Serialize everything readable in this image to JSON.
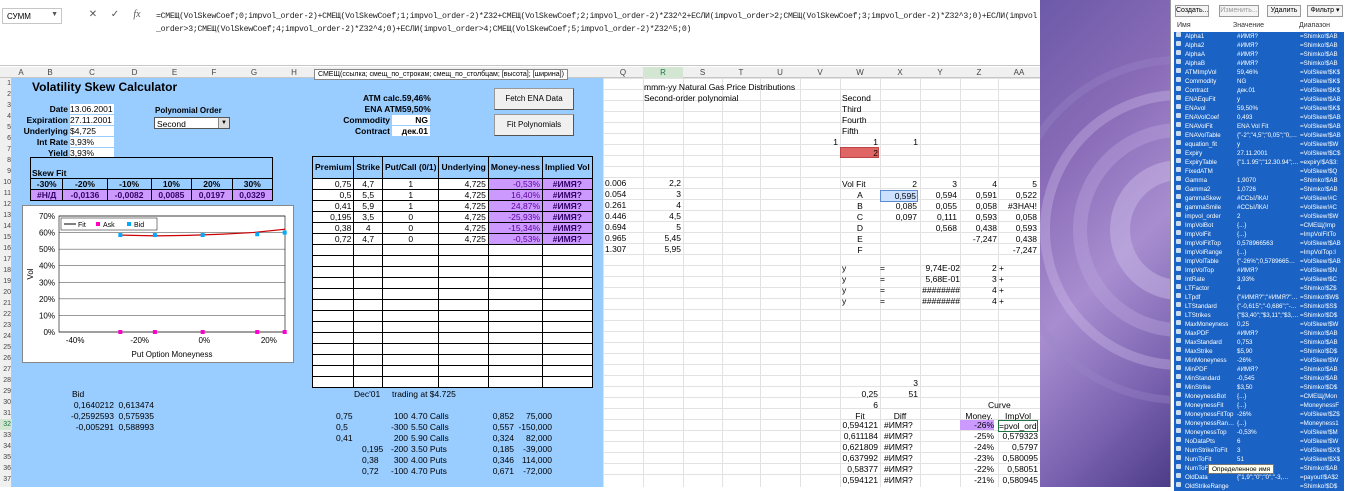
{
  "formula_bar": {
    "name_box": "СУММ",
    "cancel": "✕",
    "confirm": "✓",
    "fx": "fx",
    "formula": "=СМЕЩ(VolSkewCoef;0;impvol_order-2)+СМЕЩ(VolSkewCoef;1;impvol_order-2)*Z32+СМЕЩ(VolSkewCoef;2;impvol_order-2)*Z32^2+ЕСЛИ(impvol_order>2;СМЕЩ(VolSkewCoef;3;impvol_order-2)*Z32^3;0)+ЕСЛИ(impvol_order>3;СМЕЩ(VolSkewCoef;4;impvol_order-2)*Z32^4;0)+ЕСЛИ(impvol_order>4;СМЕЩ(VolSkewCoef;5;impvol_order-2)*Z32^5;0)",
    "tooltip": "СМЕЩ(ссылка; смещ_по_строкам; смещ_по_столбцам; [высота]; [ширина])"
  },
  "columns": [
    "A",
    "B",
    "C",
    "D",
    "E",
    "F",
    "G",
    "H",
    "",
    "",
    "",
    "",
    "",
    "",
    "",
    "Q",
    "R",
    "S",
    "T",
    "U",
    "V",
    "W",
    "X",
    "Y",
    "Z",
    "AA"
  ],
  "rows": [
    "1",
    "2",
    "3",
    "4",
    "5",
    "6",
    "7",
    "8",
    "9",
    "10",
    "11",
    "12",
    "13",
    "14",
    "15",
    "16",
    "17",
    "18",
    "19",
    "20",
    "21",
    "22",
    "23",
    "24",
    "25",
    "26",
    "27",
    "28",
    "29",
    "30",
    "31",
    "32",
    "33",
    "34",
    "35",
    "36",
    "37"
  ],
  "calc": {
    "title": "Volatility Skew Calculator",
    "date_label": "Date",
    "date": "13.06.2001",
    "exp_label": "Expiration",
    "exp": "27.11.2001",
    "und_label": "Underlying",
    "und": "$4,725",
    "ir_label": "Int Rate",
    "ir": "3,93%",
    "yield_label": "Yield",
    "yield": "3,93%",
    "poly_label": "Polynomial Order",
    "poly_value": "Second",
    "atm_calc_label": "ATM calc.",
    "atm_calc": "59,46%",
    "ena_atm_label": "ENA ATM",
    "ena_atm": "59,50%",
    "comm_label": "Commodity",
    "comm": "NG",
    "contract_label": "Contract",
    "contract": "дек.01",
    "fetch_btn": "Fetch ENA Data",
    "fit_btn": "Fit Polynomials"
  },
  "skew": {
    "label": "Skew Fit",
    "headers": [
      "-30%",
      "-20%",
      "-10%",
      "10%",
      "20%",
      "30%"
    ],
    "values": [
      "#Н/Д",
      "-0,0136",
      "-0,0082",
      "0,0085",
      "0,0197",
      "0,0329"
    ]
  },
  "options": {
    "headers": [
      "Premium",
      "Strike",
      "Put/Call (0/1)",
      "Underlying",
      "Money-ness",
      "Implied Vol"
    ],
    "rows": [
      [
        "0,75",
        "4,7",
        "1",
        "4,725",
        "-0,53%",
        "#ИМЯ?"
      ],
      [
        "0,5",
        "5,5",
        "1",
        "4,725",
        "16,40%",
        "#ИМЯ?"
      ],
      [
        "0,41",
        "5,9",
        "1",
        "4,725",
        "24,87%",
        "#ИМЯ?"
      ],
      [
        "0,195",
        "3,5",
        "0",
        "4,725",
        "-25,93%",
        "#ИМЯ?"
      ],
      [
        "0,38",
        "4",
        "0",
        "4,725",
        "-15,34%",
        "#ИМЯ?"
      ],
      [
        "0,72",
        "4,7",
        "0",
        "4,725",
        "-0,53%",
        "#ИМЯ?"
      ]
    ]
  },
  "chart": {
    "legend": [
      "Fit",
      "Ask",
      "Bid"
    ],
    "ylabel": "Vol",
    "xlabel": "Put Option Moneyness",
    "yticks": [
      "70%",
      "60%",
      "50%",
      "40%",
      "30%",
      "20%",
      "10%",
      "0%"
    ],
    "xticks": [
      "-40%",
      "-20%",
      "0%",
      "20%"
    ]
  },
  "bottom": {
    "bid": "Bid",
    "coef": [
      [
        "0,1640212",
        "0,613474"
      ],
      [
        "-0,2592593",
        "0,575935"
      ],
      [
        "-0,005291",
        "0,588993"
      ]
    ],
    "dec": "Dec'01",
    "trading": "trading at $4.725",
    "trades": [
      [
        "0,75",
        "100",
        "4.70 Calls",
        "0,852",
        "75,000"
      ],
      [
        "0,5",
        "-300",
        "5.50 Calls",
        "0,557",
        "-150,000"
      ],
      [
        "0,41",
        "200",
        "5.90 Calls",
        "0,324",
        "82,000"
      ],
      [
        "0,195",
        "-200",
        "3.50 Puts",
        "0,185",
        "-39,000"
      ],
      [
        "0,38",
        "300",
        "4.00 Puts",
        "0,346",
        "114,000"
      ],
      [
        "0,72",
        "-100",
        "4.70 Puts",
        "0,671",
        "-72,000"
      ]
    ]
  },
  "right": {
    "title1": "mmm-yy Natural Gas Price Distributions",
    "title2": "Second-order polynomial",
    "qr": [
      [
        "0.006",
        "2,2"
      ],
      [
        "0.054",
        "3"
      ],
      [
        "0.261",
        "4"
      ],
      [
        "0.446",
        "4,5"
      ],
      [
        "0.694",
        "5"
      ],
      [
        "0.965",
        "5,45"
      ],
      [
        "1.307",
        "5,95"
      ]
    ],
    "orders": [
      "Second",
      "Third",
      "Fourth",
      "Fifth"
    ],
    "w6": "1",
    "x6": "1",
    "y6": "1",
    "v6": "1",
    "w7": "2",
    "volfit": "Vol Fit",
    "vhead": [
      "2",
      "3",
      "4",
      "5"
    ],
    "vlabels": [
      "A",
      "B",
      "C",
      "D",
      "E",
      "F"
    ],
    "vrows": [
      [
        "0,595",
        "0,594",
        "0,591",
        "0,522"
      ],
      [
        "0,085",
        "0,055",
        "0,058",
        "#ЗНАЧ!"
      ],
      [
        "0,097",
        "0,111",
        "0,593",
        "0,058"
      ],
      [
        "",
        "0,568",
        "0,438",
        "0,593"
      ],
      [
        "",
        "",
        "-7,247",
        "0,438"
      ],
      [
        "",
        "",
        "",
        "-7,247"
      ]
    ],
    "yrows": [
      [
        "y",
        "=",
        "9,74E-02",
        "2 +"
      ],
      [
        "y",
        "=",
        "5,68E-01",
        "3 +"
      ],
      [
        "y",
        "=",
        "########",
        "4 +"
      ],
      [
        "y",
        "=",
        "########",
        "4 +"
      ]
    ],
    "x28": "3",
    "w29": "0,25",
    "x29": "51",
    "w30": "6",
    "curve": "Curve",
    "fit_h": "Fit",
    "diff_h": "Diff",
    "money_h": "Money.",
    "impvol_h": "ImpVol",
    "fitrows": [
      [
        "0,594121",
        "#ИМЯ?",
        "-26%",
        "=pvol_order-"
      ],
      [
        "0,611184",
        "#ИМЯ?",
        "-25%",
        "0,579323"
      ],
      [
        "0,621809",
        "#ИМЯ?",
        "-24%",
        "0,5797"
      ],
      [
        "0,637992",
        "#ИМЯ?",
        "-23%",
        "0,580095"
      ],
      [
        "0,58377",
        "#ИМЯ?",
        "-22%",
        "0,58051"
      ],
      [
        "0,594121",
        "#ИМЯ?",
        "-21%",
        "0,580945"
      ]
    ]
  },
  "dock": {
    "btn_create": "Создать...",
    "btn_edit": "Изменить...",
    "btn_delete": "Удалить",
    "btn_filter": "Фильтр ▾",
    "h_name": "Имя",
    "h_value": "Значение",
    "h_range": "Диапазон",
    "tip": "Определенное имя",
    "items": [
      [
        "Alpha1",
        "#ИМЯ?",
        "=Shimko!$AB"
      ],
      [
        "Alpha2",
        "#ИМЯ?",
        "=Shimko!$AB"
      ],
      [
        "AlphaA",
        "#ИМЯ?",
        "=Shimko!$AB"
      ],
      [
        "AlphaB",
        "#ИМЯ?",
        "=Shimko!$AB"
      ],
      [
        "ATMImpVol",
        "59,46%",
        "=VolSkew!$K$"
      ],
      [
        "Commodity",
        "NG",
        "=VolSkew!$K$"
      ],
      [
        "Contract",
        "дек.01",
        "=VolSkew!$K$"
      ],
      [
        "ENAEquFit",
        "y",
        "=VolSkew!$AB"
      ],
      [
        "ENAvol",
        "59,50%",
        "=VolSkew!$K$"
      ],
      [
        "ENAVolCoef",
        "0,493",
        "=VolSkew!$AB"
      ],
      [
        "ENAVolFit",
        "ENA Vol Fit",
        "=VolSkew!$AB"
      ],
      [
        "ENAVolTable",
        "{\"-2\";\"4,5\";\"0,05\";\"0,…",
        "=VolSkew!$AB"
      ],
      [
        "equation_fit",
        "y",
        "=VolSkew!$W"
      ],
      [
        "Expiry",
        "27.11.2001",
        "=VolSkew!$C$"
      ],
      [
        "ExpiryTable",
        "{\"1.1.95\";\"12.30.94\";…",
        "=expiry!$A$3:"
      ],
      [
        "FixedATM",
        "",
        "=VolSkew!$Q"
      ],
      [
        "Gamma",
        "1,9070",
        "=Shimko!$AB"
      ],
      [
        "Gamma2",
        "1,0726",
        "=Shimko!$AB"
      ],
      [
        "gammaSkew",
        "#ССЫЛКА!",
        "=VolSkew!#C"
      ],
      [
        "gammaSmile",
        "#ССЫЛКА!",
        "=VolSkew!#C"
      ],
      [
        "impvol_order",
        "2",
        "=VolSkew!$W"
      ],
      [
        "ImpVolBot",
        "{...}",
        "=СМЕЩ(Imp"
      ],
      [
        "ImpVolFit",
        "{...}",
        "=ImpVolFitTo"
      ],
      [
        "ImpVolFitTop",
        "0,578966563",
        "=VolSkew!$AB"
      ],
      [
        "ImpVolRange",
        "{...}",
        "=ImpVolTop:I"
      ],
      [
        "ImpVolTable",
        "{\"-26%\";0,5789665…",
        "=VolSkew!$AB"
      ],
      [
        "ImpVolTop",
        "#ИМЯ?",
        "=VolSkew!$N"
      ],
      [
        "IntRate",
        "3,93%",
        "=VolSkew!$C"
      ],
      [
        "LTFactor",
        "4",
        "=Shimko!$Z$"
      ],
      [
        "LTpdf",
        "{\"#ИМЯ?\";\"#ИМЯ?\"…",
        "=Shimko!$W$"
      ],
      [
        "LTStandard",
        "{\"-0,615\";\"-0,686\";\"-…",
        "=Shimko!$S$"
      ],
      [
        "LTStrikes",
        "{\"$3,40\";\"$3,11\";\"$3,…",
        "=Shimko!$D$"
      ],
      [
        "MaxMoneyness",
        "0,25",
        "=VolSkew!$W"
      ],
      [
        "MaxPDF",
        "#ИМЯ?",
        "=Shimko!$AB"
      ],
      [
        "MaxStandard",
        "0,753",
        "=Shimko!$AB"
      ],
      [
        "MaxStrike",
        "$5,90",
        "=Shimko!$D$"
      ],
      [
        "MinMoneyness",
        "-26%",
        "=VolSkew!$W"
      ],
      [
        "MinPDF",
        "#ИМЯ?",
        "=Shimko!$AB"
      ],
      [
        "MinStandard",
        "-0,545",
        "=Shimko!$AB"
      ],
      [
        "MinStrike",
        "$3,50",
        "=Shimko!$D$"
      ],
      [
        "MoneynessBot",
        "{...}",
        "=СМЕЩ(Mon"
      ],
      [
        "MoneynessFit",
        "{...}",
        "=MoneynessF"
      ],
      [
        "MoneynessFitTop",
        "-26%",
        "=VolSkew!$Z$"
      ],
      [
        "MoneynessRan…",
        "{...}",
        "=Moneyness1"
      ],
      [
        "MoneynessTop",
        "-0,53%",
        "=VolSkew!$M"
      ],
      [
        "NoDataPts",
        "6",
        "=VolSkew!$W"
      ],
      [
        "NumStrikeToFit",
        "3",
        "=VolSkew!$X$"
      ],
      [
        "NumToFit",
        "51",
        "=VolSkew!$X$"
      ],
      [
        "NumToFit…",
        "",
        "=Shimko!$AB"
      ],
      [
        "OldData",
        "{\"1,9\";\"0\";\"0\";\"-3,…",
        "=payout!$A$2"
      ],
      [
        "OldStrikeRange",
        "",
        "=Shimko!$D$"
      ]
    ]
  }
}
